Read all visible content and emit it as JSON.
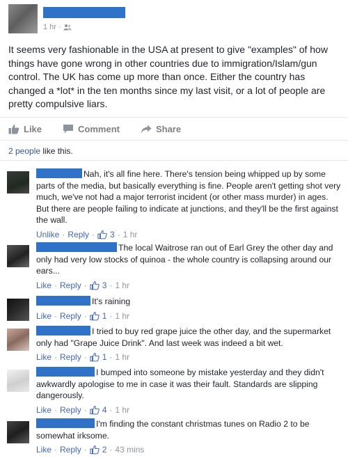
{
  "post": {
    "time": "1 hr",
    "body": "It seems very fashionable in the USA at present to give \"examples\" of how things have gone wrong in other countries due to immigration/Islam/gun control. The UK has come up more than once. Either the country has changed a *lot* in the ten months since my last visit, or a lot of people are pretty compulsive liars.",
    "actions": {
      "like": "Like",
      "comment": "Comment",
      "share": "Share"
    },
    "likes_count_text": "2 people",
    "likes_suffix": " like this."
  },
  "comments": [
    {
      "text": "Nah, it's all fine here. There's tension being whipped up by some parts of the media, but basically everything is fine. People aren't getting shot very much, we've not had a major terrorist incident (or other mass murder) in ages. But there are people failing to indicate at junctions, and they'll be the first against the wall.",
      "like_label": "Unlike",
      "reply_label": "Reply",
      "likes": "3",
      "time": "1 hr"
    },
    {
      "text": "The local Waitrose ran out of Earl Grey the other day and only had very low stocks of quinoa - the whole country is collapsing around our ears...",
      "like_label": "Like",
      "reply_label": "Reply",
      "likes": "3",
      "time": "1 hr"
    },
    {
      "text": "It's raining",
      "like_label": "Like",
      "reply_label": "Reply",
      "likes": "1",
      "time": "1 hr"
    },
    {
      "text": "I tried to buy red grape juice the other day, and the supermarket only had \"Grape Juice Drink\". And last week was indeed a bit wet.",
      "like_label": "Like",
      "reply_label": "Reply",
      "likes": "1",
      "time": "1 hr"
    },
    {
      "text": "I bumped into someone by mistake yesterday and they didn't awkwardly apologise to me in case it was their fault. Standards are slipping dangerously.",
      "like_label": "Like",
      "reply_label": "Reply",
      "likes": "4",
      "time": "1 hr"
    },
    {
      "text": "I'm finding the constant christmas tunes on Radio 2 to be somewhat irksome.",
      "like_label": "Like",
      "reply_label": "Reply",
      "likes": "2",
      "time": "43 mins"
    }
  ],
  "colors": {
    "link": "#4267b2",
    "redaction": "#2f72c8",
    "meta": "#90949c"
  }
}
